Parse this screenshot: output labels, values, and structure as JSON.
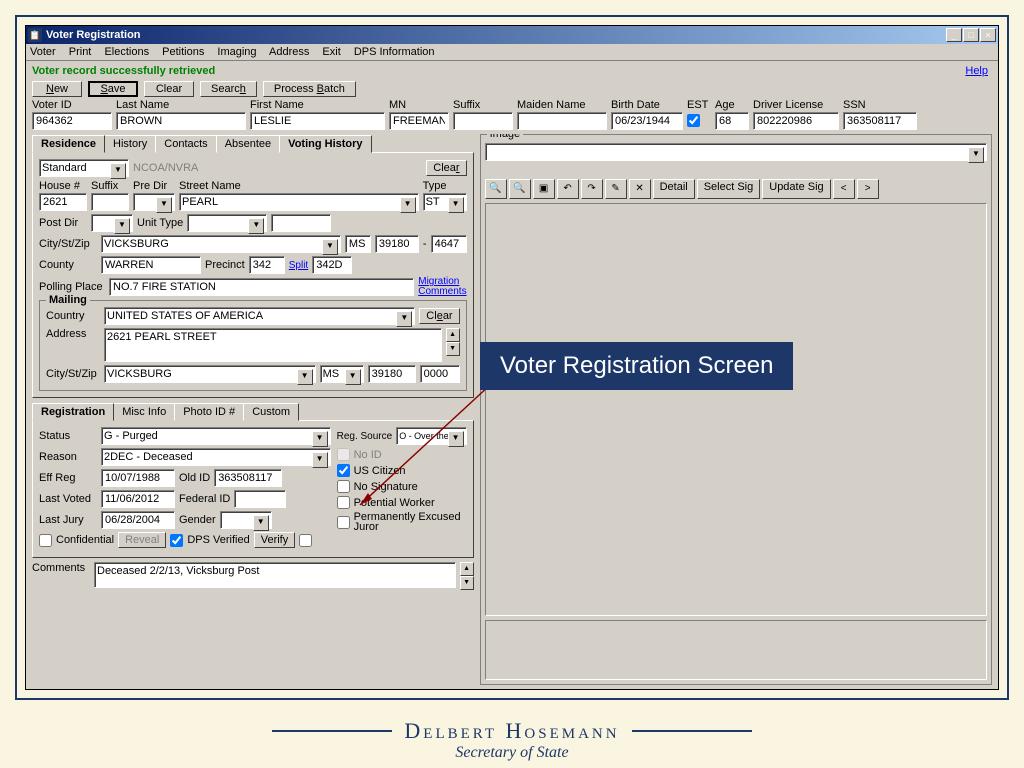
{
  "window_title": "Voter Registration",
  "menu": [
    "Voter",
    "Print",
    "Elections",
    "Petitions",
    "Imaging",
    "Address",
    "Exit",
    "DPS Information"
  ],
  "status_message": "Voter record successfully retrieved",
  "help": "Help",
  "toolbar": {
    "new": "New",
    "save": "Save",
    "clear": "Clear",
    "search": "Search",
    "process": "Process Batch"
  },
  "ident": {
    "voter_id_label": "Voter ID",
    "voter_id": "964362",
    "last_label": "Last Name",
    "last": "BROWN",
    "first_label": "First Name",
    "first": "LESLIE",
    "mn_label": "MN",
    "mn": "FREEMAN",
    "suffix_label": "Suffix",
    "suffix": "",
    "maiden_label": "Maiden Name",
    "maiden": "",
    "birth_label": "Birth Date",
    "birth": "06/23/1944",
    "est_label": "EST",
    "age_label": "Age",
    "age": "68",
    "dl_label": "Driver License",
    "dl": "802220986",
    "ssn_label": "SSN",
    "ssn": "363508117"
  },
  "tabs_top": [
    "Residence",
    "History",
    "Contacts",
    "Absentee",
    "Voting History"
  ],
  "residence": {
    "addr_type": "Standard",
    "ncoa": "NCOA/NVRA",
    "clear": "Clear",
    "house_label": "House #",
    "house": "2621",
    "suffix_label": "Suffix",
    "suffix": "",
    "predir_label": "Pre Dir",
    "predir": "",
    "street_label": "Street Name",
    "street": "PEARL",
    "type_label": "Type",
    "type": "ST",
    "postdir_label": "Post Dir",
    "postdir": "",
    "unittype_label": "Unit Type",
    "unittype": "",
    "unit": "",
    "cityzip_label": "City/St/Zip",
    "city": "VICKSBURG",
    "st": "MS",
    "zip": "39180",
    "zip4": "4647",
    "county_label": "County",
    "county": "WARREN",
    "precinct_label": "Precinct",
    "precinct": "342",
    "split": "Split",
    "split_val": "342D",
    "poll_label": "Polling Place",
    "poll": "NO.7 FIRE STATION",
    "migration": "Migration",
    "comments_link": "Comments"
  },
  "mailing": {
    "legend": "Mailing",
    "country_label": "Country",
    "country": "UNITED STATES OF AMERICA",
    "clear": "Clear",
    "addr_label": "Address",
    "addr": "2621 PEARL STREET",
    "cityzip_label": "City/St/Zip",
    "city": "VICKSBURG",
    "st": "MS",
    "zip": "39180",
    "zip4": "0000"
  },
  "tabs_reg": [
    "Registration",
    "Misc Info",
    "Photo ID #",
    "Custom"
  ],
  "reg": {
    "status_label": "Status",
    "status": "G - Purged",
    "regsrc_label": "Reg. Source",
    "regsrc": "O - Over the C",
    "reason_label": "Reason",
    "reason": "2DEC - Deceased",
    "effreg_label": "Eff Reg",
    "effreg": "10/07/1988",
    "oldid_label": "Old ID",
    "oldid": "363508117",
    "lastvoted_label": "Last Voted",
    "lastvoted": "11/06/2012",
    "federalid_label": "Federal ID",
    "federalid": "",
    "lastjury_label": "Last Jury",
    "lastjury": "06/28/2004",
    "gender_label": "Gender",
    "gender": "",
    "confidential": "Confidential",
    "reveal": "Reveal",
    "dpsverified": "DPS Verified",
    "verify": "Verify",
    "noid": "No ID",
    "citizen": "US Citizen",
    "nosig": "No Signature",
    "potworker": "Potential Worker",
    "excused": "Permanently Excused Juror"
  },
  "comments_label": "Comments",
  "comments": "Deceased 2/2/13, Vicksburg Post",
  "image_panel": {
    "legend": "Image",
    "detail": "Detail",
    "selectsig": "Select Sig",
    "updatesig": "Update Sig"
  },
  "callout": "Voter Registration Screen",
  "footer": {
    "name": "Delbert Hosemann",
    "sub": "Secretary of State"
  }
}
